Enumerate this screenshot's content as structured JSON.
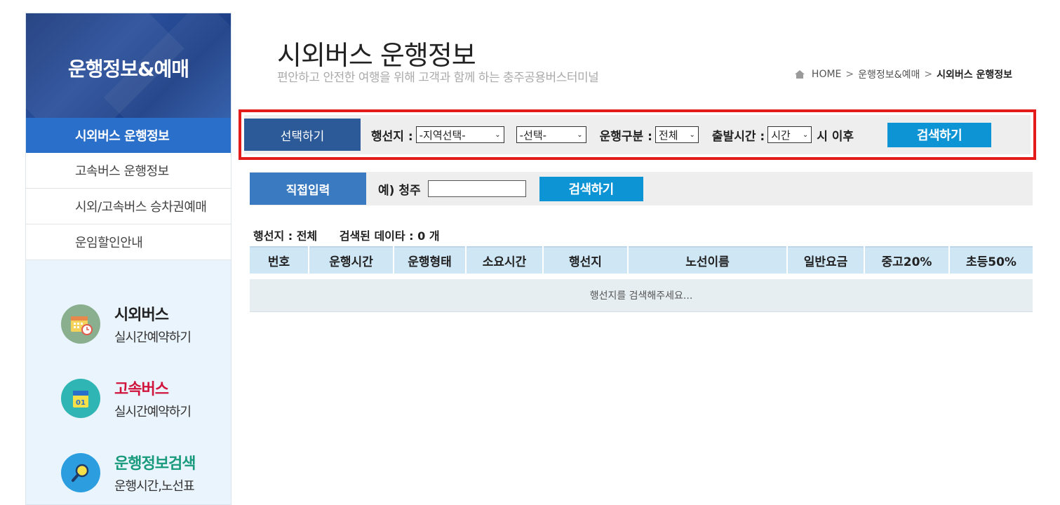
{
  "sidebar": {
    "title": "운행정보&예매",
    "menu": [
      {
        "label": "시외버스 운행정보",
        "active": true
      },
      {
        "label": "고속버스 운행정보",
        "active": false
      },
      {
        "label": "시외/고속버스 승차권예매",
        "active": false
      },
      {
        "label": "운임할인안내",
        "active": false
      }
    ],
    "quick": [
      {
        "title": "시외버스",
        "sub": "실시간예약하기",
        "icon": "calendar-clock-icon"
      },
      {
        "title": "고속버스",
        "sub": "실시간예약하기",
        "icon": "calendar-01-icon"
      },
      {
        "title": "운행정보검색",
        "sub": "운행시간,노선표",
        "icon": "magnifier-icon"
      }
    ]
  },
  "header": {
    "title": "시외버스 운행정보",
    "subtitle": "편안하고 안전한 여행을 위해 고객과 함께 하는 충주공용버스터미널",
    "breadcrumb": [
      "HOME",
      "운행정보&예매",
      "시외버스 운행정보"
    ]
  },
  "search": {
    "tab": "선택하기",
    "dest_label": "행선지 :",
    "region_select": "-지역선택-",
    "sub_select": "-선택-",
    "type_label": "운행구분 :",
    "type_select": "전체",
    "time_label": "출발시간 :",
    "time_select": "시간",
    "time_suffix": "시 이후",
    "button": "검색하기"
  },
  "direct": {
    "tab": "직접입력",
    "example": "예) 청주",
    "input_value": "",
    "button": "검색하기"
  },
  "result": {
    "dest": "행선지 : 전체",
    "count": "검색된 데이타 : 0 개"
  },
  "table": {
    "headers": [
      "번호",
      "운행시간",
      "운행형태",
      "소요시간",
      "행선지",
      "노선이름",
      "일반요금",
      "중고20%",
      "초등50%"
    ],
    "empty_message": "행선지를 검색해주세요..."
  },
  "colors": {
    "accent": "#2a6fc9",
    "search_button": "#0d94d4",
    "highlight_border": "#e41b1b"
  }
}
